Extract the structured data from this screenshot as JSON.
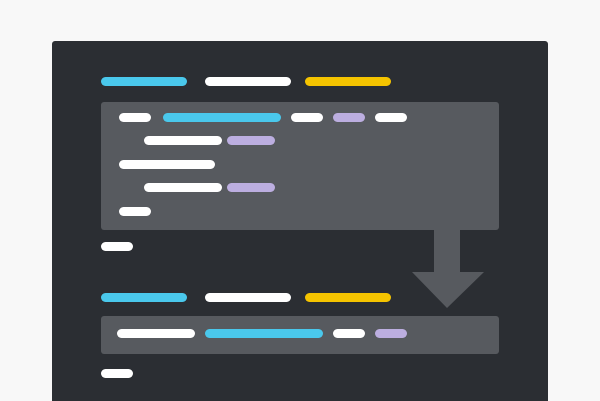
{
  "illustration": {
    "description_icon": "code-refactor-illustration-icon",
    "colors": {
      "page_background": "#f8f8f8",
      "editor_background": "#2b2e33",
      "code_block_background": "#575a5f",
      "arrow": "#575a5f",
      "token_cyan": "#4ac8ec",
      "token_white": "#ffffff",
      "token_yellow": "#f5c400",
      "token_lavender": "#bcaee0"
    },
    "before_block": {
      "header_tokens": [
        "cyan",
        "white",
        "yellow"
      ],
      "lines": [
        [
          "white",
          "cyan",
          "white",
          "lavender",
          "white"
        ],
        [
          "white",
          "lavender"
        ],
        [
          "white"
        ],
        [
          "white",
          "lavender"
        ],
        [
          "white"
        ]
      ],
      "trailing_token": "white"
    },
    "after_block": {
      "header_tokens": [
        "cyan",
        "white",
        "yellow"
      ],
      "lines": [
        [
          "white",
          "cyan",
          "white",
          "lavender"
        ]
      ],
      "trailing_token": "white"
    },
    "arrow_direction": "down"
  }
}
